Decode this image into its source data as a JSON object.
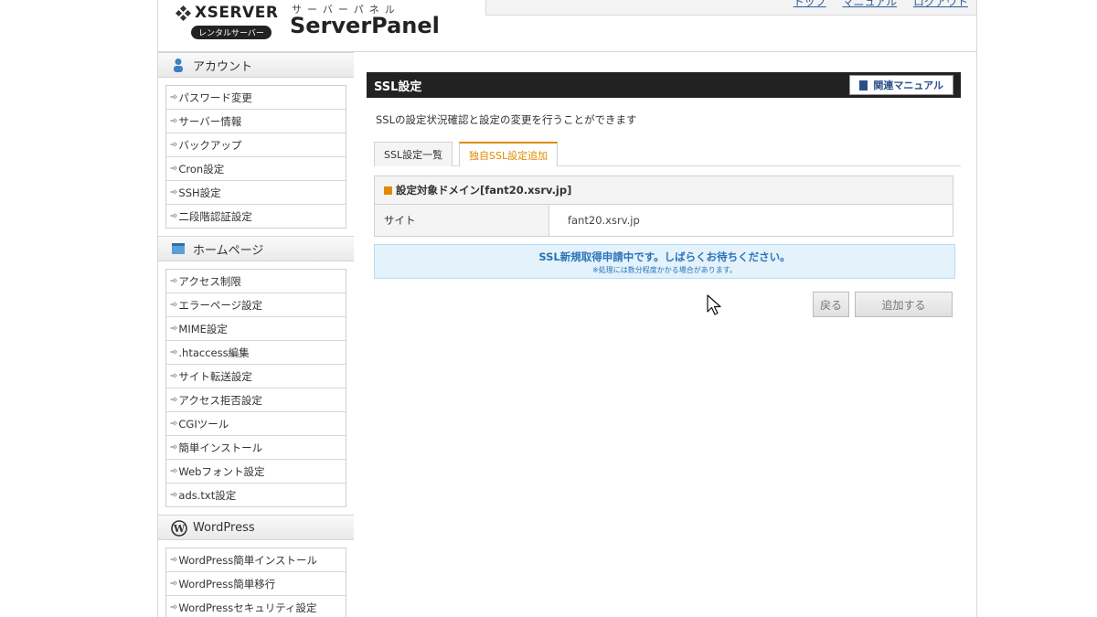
{
  "header": {
    "brand": "XSERVER",
    "brand_badge": "レンタルサーバー",
    "panel_kana": "サーバーパネル",
    "panel_title": "ServerPanel",
    "nav": [
      "トップ",
      "マニュアル",
      "ログアウト"
    ]
  },
  "sidebar": {
    "sections": [
      {
        "title": "アカウント",
        "icon": "person-icon",
        "items": [
          "パスワード変更",
          "サーバー情報",
          "バックアップ",
          "Cron設定",
          "SSH設定",
          "二段階認証設定"
        ]
      },
      {
        "title": "ホームページ",
        "icon": "homepage-icon",
        "items": [
          "アクセス制限",
          "エラーページ設定",
          "MIME設定",
          ".htaccess編集",
          "サイト転送設定",
          "アクセス拒否設定",
          "CGIツール",
          "簡単インストール",
          "Webフォント設定",
          "ads.txt設定"
        ]
      },
      {
        "title": "WordPress",
        "icon": "wordpress-icon",
        "items": [
          "WordPress簡単インストール",
          "WordPress簡単移行",
          "WordPressセキュリティ設定"
        ]
      }
    ]
  },
  "main": {
    "title": "SSL設定",
    "manual_label": "関連マニュアル",
    "description": "SSLの設定状況確認と設定の変更を行うことができます",
    "tabs": [
      {
        "label": "SSL設定一覧",
        "active": false
      },
      {
        "label": "独自SSL設定追加",
        "active": true
      }
    ],
    "target_heading": "設定対象ドメイン[fant20.xsrv.jp]",
    "row_key": "サイト",
    "row_value": "fant20.xsrv.jp",
    "notice_main": "SSL新規取得申請中です。しばらくお待ちください。",
    "notice_sub": "※処理には数分程度かかる場合があります。",
    "back_label": "戻る",
    "add_label": "追加する"
  },
  "colors": {
    "accent_orange": "#e08a00",
    "notice_blue": "#2b73b8",
    "title_bar": "#222222"
  }
}
